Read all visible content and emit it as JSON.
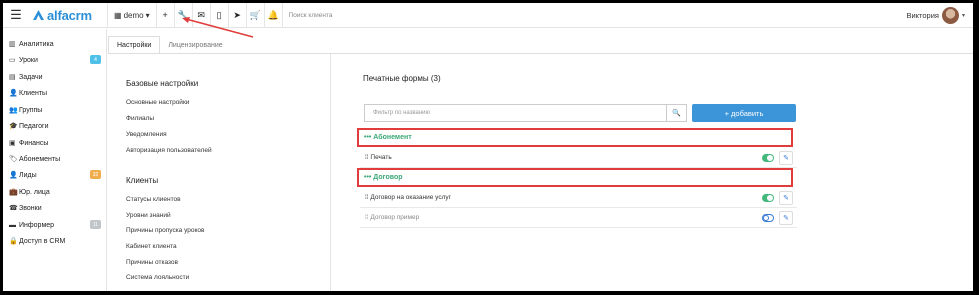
{
  "app": {
    "logo_text": "alfacrm",
    "brand_color": "#2b8fd6"
  },
  "topbar": {
    "branch": "demo",
    "branch_caret": "▾",
    "buttons": [
      {
        "name": "add-icon",
        "glyph": "+"
      },
      {
        "name": "wrench-icon",
        "glyph": "🔧"
      },
      {
        "name": "mail-icon",
        "glyph": "✉"
      },
      {
        "name": "phone-icon",
        "glyph": "▯"
      },
      {
        "name": "telegram-icon",
        "glyph": "➤"
      },
      {
        "name": "cart-icon",
        "glyph": "🛒"
      },
      {
        "name": "bell-icon",
        "glyph": "🔔"
      }
    ],
    "search_placeholder": "Поиск клиента",
    "user_name": "Виктория"
  },
  "sidebar": {
    "items": [
      {
        "icon": "chart-icon",
        "glyph": "▥",
        "label": "Аналитика"
      },
      {
        "icon": "lesson-icon",
        "glyph": "▭",
        "label": "Уроки",
        "badge": "4",
        "badge_color": "#4fc1e9"
      },
      {
        "icon": "tasks-icon",
        "glyph": "▤",
        "label": "Задачи"
      },
      {
        "icon": "user-icon",
        "glyph": "👤",
        "label": "Клиенты"
      },
      {
        "icon": "users-icon",
        "glyph": "👥",
        "label": "Группы"
      },
      {
        "icon": "graduation-icon",
        "glyph": "🎓",
        "label": "Педагоги"
      },
      {
        "icon": "money-icon",
        "glyph": "▣",
        "label": "Финансы"
      },
      {
        "icon": "tag-icon",
        "glyph": "🏷",
        "label": "Абонементы"
      },
      {
        "icon": "leads-icon",
        "glyph": "👤",
        "label": "Лиды",
        "badge": "32",
        "badge_color": "#f0ad4e"
      },
      {
        "icon": "briefcase-icon",
        "glyph": "💼",
        "label": "Юр. лица"
      },
      {
        "icon": "phone-call-icon",
        "glyph": "☎",
        "label": "Звонки"
      },
      {
        "icon": "informer-icon",
        "glyph": "▬",
        "label": "Информер",
        "badge": "11",
        "badge_color": "#bfc5c9"
      },
      {
        "icon": "lock-icon",
        "glyph": "🔒",
        "label": "Доступ в CRM"
      }
    ]
  },
  "tabs": [
    {
      "label": "Настройки",
      "active": true
    },
    {
      "label": "Лицензирование",
      "active": false
    }
  ],
  "settings_menu": {
    "basic_title": "Базовые настройки",
    "basic_items": [
      "Основные настройки",
      "Филиалы",
      "Уведомления",
      "Авторизация пользователей"
    ],
    "clients_title": "Клиенты",
    "clients_items": [
      "Статусы клиентов",
      "Уровни знаний",
      "Причины пропуска уроков",
      "Кабинет клиента",
      "Причины отказов",
      "Система лояльности"
    ]
  },
  "print_forms": {
    "title": "Печатные формы (3)",
    "filter_placeholder": "Фильтр по названию",
    "add_label": "+ добавить",
    "groups": [
      {
        "label": "••• Абонемент",
        "rows": [
          {
            "label": "⁞⁞ Печать",
            "enabled": true
          }
        ]
      },
      {
        "label": "••• Договор",
        "rows": [
          {
            "label": "⁞⁞ Договор на оказание услуг",
            "enabled": true
          },
          {
            "label": "⁞⁞ Договор пример",
            "enabled": false
          }
        ]
      }
    ]
  },
  "colors": {
    "highlight": "#e23b3b",
    "accent": "#3c95d8",
    "group_green": "#3aa776",
    "toggle_on": "#43b87a"
  }
}
